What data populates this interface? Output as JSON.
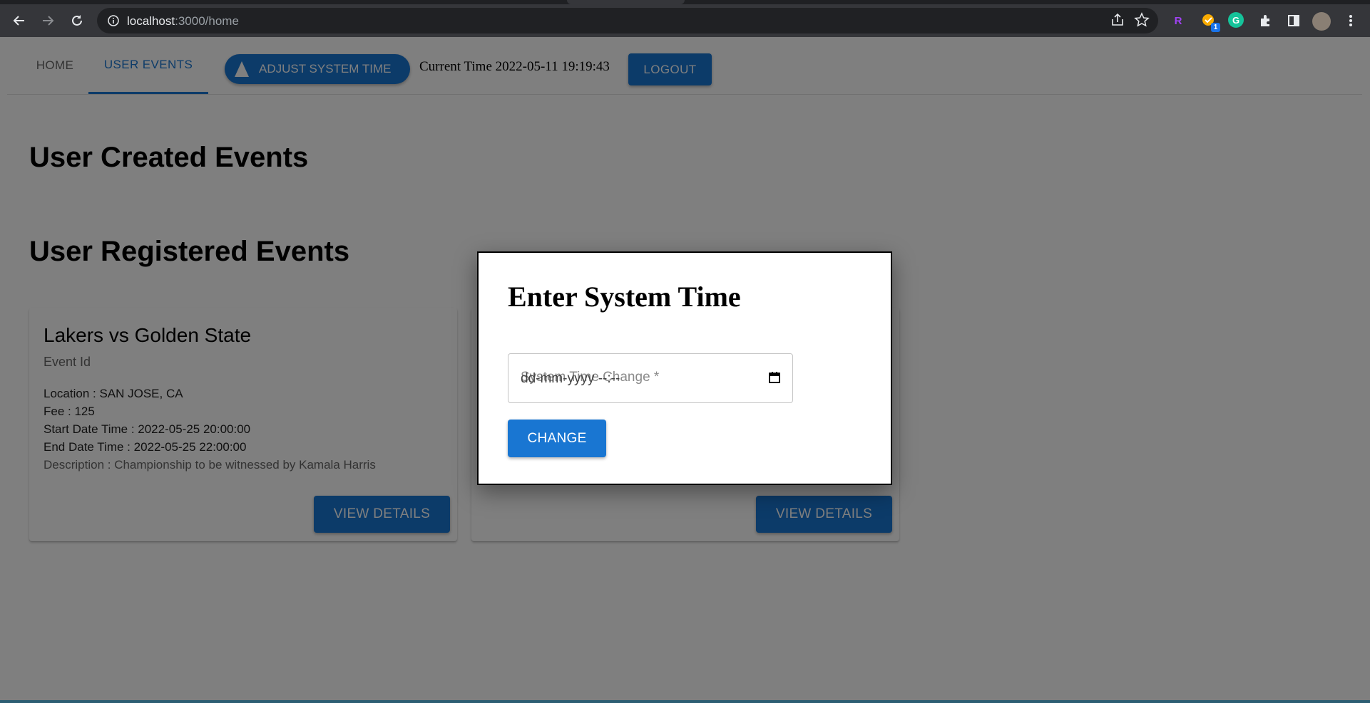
{
  "browser": {
    "url_host": "localhost",
    "url_rest": ":3000/home",
    "ext_badge": "1",
    "ext_r_label": "R",
    "ext_g_label": "G"
  },
  "nav": {
    "tabs": [
      {
        "label": "HOME"
      },
      {
        "label": "USER EVENTS"
      }
    ],
    "adjust_label": "ADJUST SYSTEM TIME",
    "current_time": "Current Time 2022-05-11 19:19:43",
    "logout_label": "LOGOUT"
  },
  "sections": {
    "created_title": "User Created Events",
    "registered_title": "User Registered Events"
  },
  "card": {
    "title": "Lakers vs Golden State",
    "subtitle": "Event Id",
    "location": "Location : SAN JOSE, CA",
    "fee": "Fee : 125",
    "start": "Start Date Time : 2022-05-25 20:00:00",
    "end": "End Date Time : 2022-05-25 22:00:00",
    "description": "Description : Championship to be witnessed by Kamala Harris",
    "details_label": "VIEW DETAILS"
  },
  "card2": {
    "details_label": "VIEW DETAILS"
  },
  "dialog": {
    "title": "Enter System Time",
    "field_label": "System Time Change *",
    "field_placeholder": "dd-mm-yyyy --:--",
    "change_label": "CHANGE"
  }
}
